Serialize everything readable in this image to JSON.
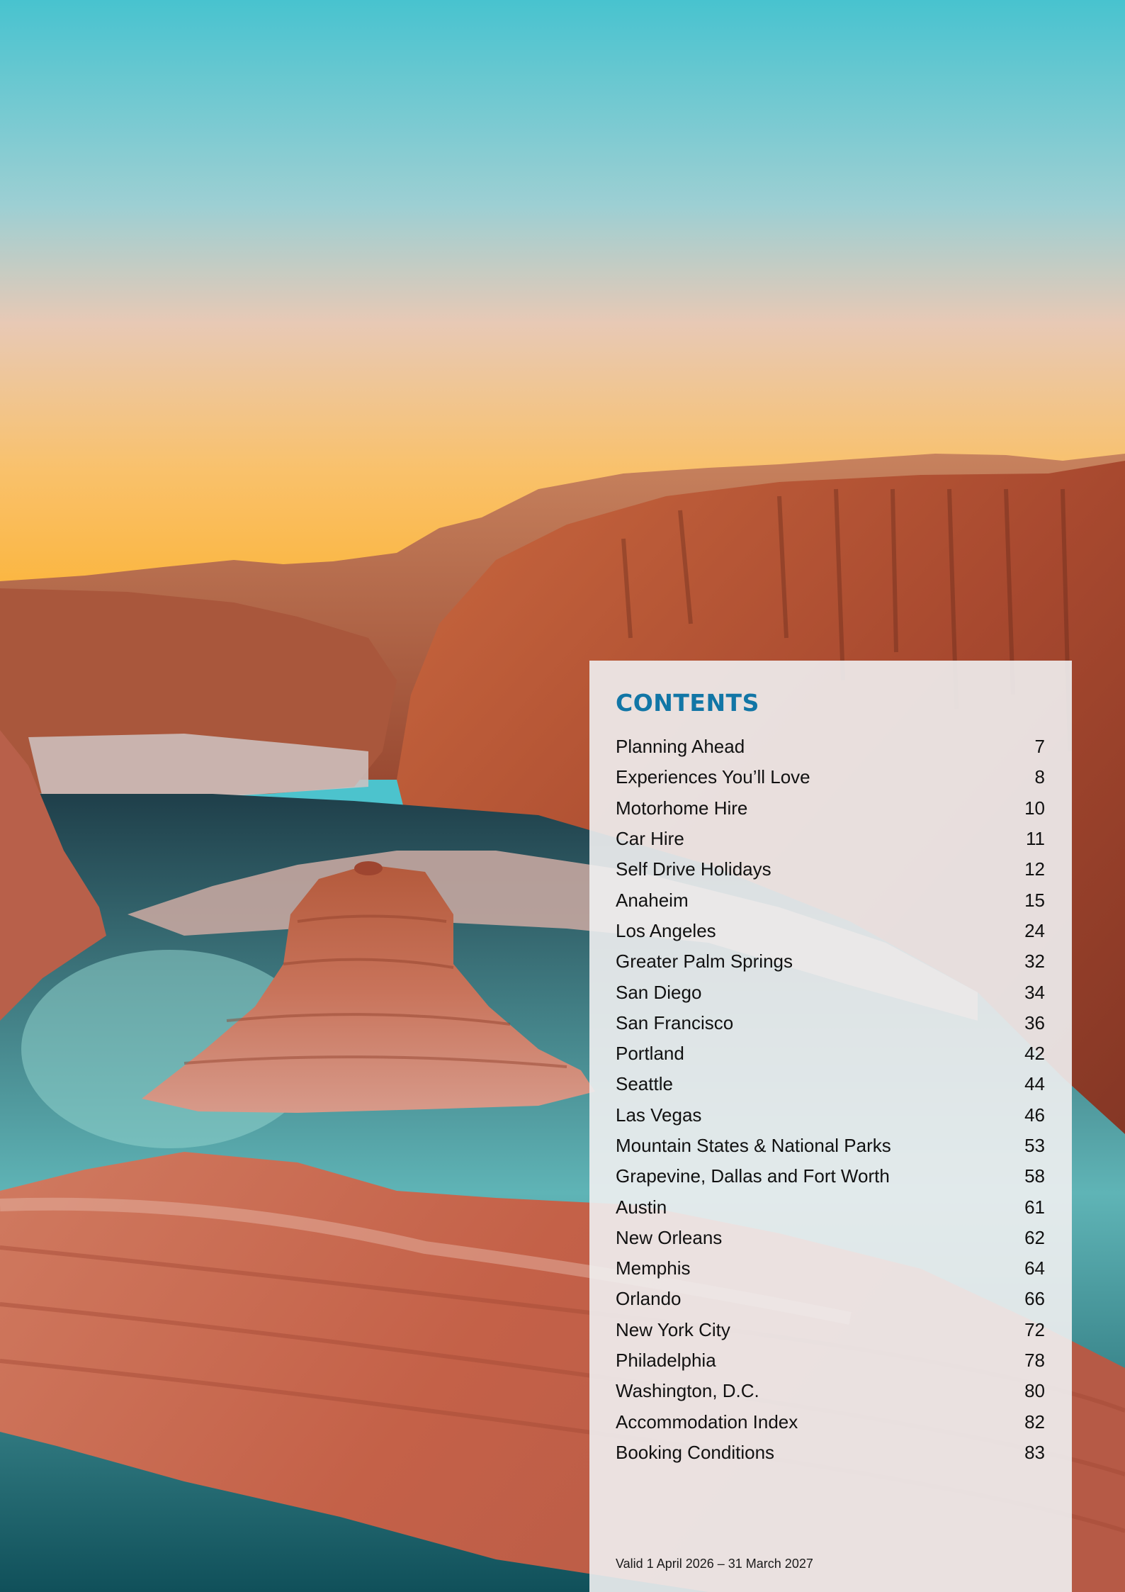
{
  "contents": {
    "title": "CONTENTS",
    "items": [
      {
        "label": "Planning Ahead",
        "page": "7"
      },
      {
        "label": "Experiences You’ll Love",
        "page": "8"
      },
      {
        "label": "Motorhome Hire",
        "page": "10"
      },
      {
        "label": "Car Hire",
        "page": "11"
      },
      {
        "label": "Self Drive Holidays",
        "page": "12"
      },
      {
        "label": "Anaheim",
        "page": "15"
      },
      {
        "label": "Los Angeles",
        "page": "24"
      },
      {
        "label": "Greater Palm Springs",
        "page": "32"
      },
      {
        "label": "San Diego",
        "page": "34"
      },
      {
        "label": "San Francisco",
        "page": "36"
      },
      {
        "label": "Portland",
        "page": "42"
      },
      {
        "label": "Seattle",
        "page": "44"
      },
      {
        "label": "Las Vegas",
        "page": "46"
      },
      {
        "label": "Mountain States & National Parks",
        "page": "53"
      },
      {
        "label": "Grapevine, Dallas and Fort Worth",
        "page": "58"
      },
      {
        "label": "Austin",
        "page": "61"
      },
      {
        "label": "New Orleans",
        "page": "62"
      },
      {
        "label": "Memphis",
        "page": "64"
      },
      {
        "label": "Orlando",
        "page": "66"
      },
      {
        "label": "New York City",
        "page": "72"
      },
      {
        "label": "Philadelphia",
        "page": "78"
      },
      {
        "label": "Washington, D.C.",
        "page": "80"
      },
      {
        "label": "Accommodation Index",
        "page": "82"
      },
      {
        "label": "Booking Conditions",
        "page": "83"
      }
    ],
    "validity": "Valid 1 April 2026 – 31 March 2027"
  },
  "colors": {
    "title_blue": "#1276a6",
    "sky_top": "#48c3cf",
    "sky_horizon": "#fbbd45",
    "rock_red": "#b5533a",
    "water_teal": "#2e7d82"
  }
}
